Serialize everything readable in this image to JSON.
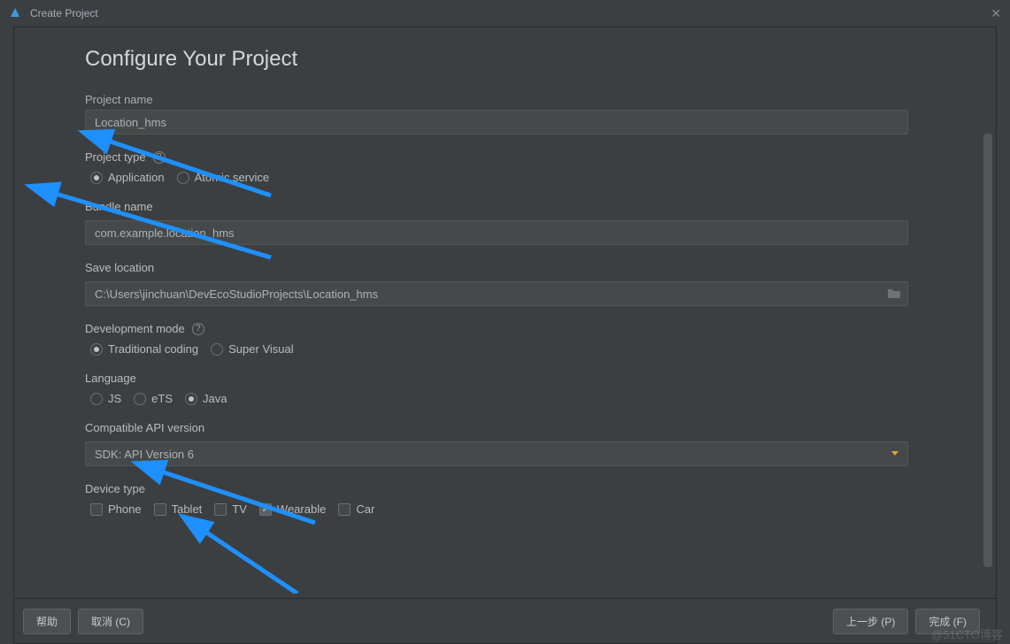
{
  "titlebar": {
    "title": "Create Project"
  },
  "heading": "Configure Your Project",
  "labels": {
    "project_name": "Project name",
    "project_type": "Project type",
    "bundle_name": "Bundle name",
    "save_location": "Save location",
    "dev_mode": "Development mode",
    "language": "Language",
    "api_version": "Compatible API version",
    "device_type": "Device type"
  },
  "project_name_value": "Location_hms",
  "project_type": {
    "options": [
      "Application",
      "Atomic service"
    ],
    "selected": "Application"
  },
  "bundle_name_value": "com.example.location_hms",
  "save_location_value": "C:\\Users\\jinchuan\\DevEcoStudioProjects\\Location_hms",
  "dev_mode": {
    "options": [
      "Traditional coding",
      "Super Visual"
    ],
    "selected": "Traditional coding"
  },
  "language": {
    "options": [
      "JS",
      "eTS",
      "Java"
    ],
    "selected": "Java"
  },
  "api_version_value": "SDK: API Version 6",
  "device_type": {
    "options": [
      "Phone",
      "Tablet",
      "TV",
      "Wearable",
      "Car"
    ],
    "checked": [
      "Wearable"
    ]
  },
  "footer": {
    "help": "帮助",
    "cancel": "取消 (C)",
    "prev": "上一步 (P)",
    "finish": "完成 (F)"
  },
  "watermark": "@51CTO博客"
}
